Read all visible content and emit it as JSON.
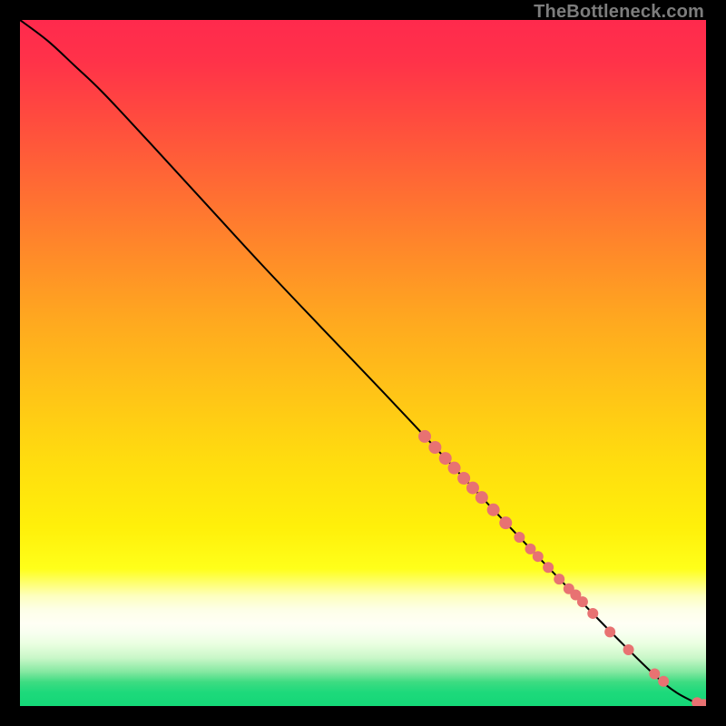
{
  "watermark": "TheBottleneck.com",
  "colors": {
    "black": "#000000",
    "curve": "#000000",
    "point": "#e87272",
    "gradient_stops": [
      {
        "offset": 0.0,
        "color": "#ff2a4d"
      },
      {
        "offset": 0.06,
        "color": "#ff3249"
      },
      {
        "offset": 0.14,
        "color": "#ff4a3f"
      },
      {
        "offset": 0.24,
        "color": "#ff6a34"
      },
      {
        "offset": 0.34,
        "color": "#ff8a29"
      },
      {
        "offset": 0.44,
        "color": "#ffa91f"
      },
      {
        "offset": 0.54,
        "color": "#ffc317"
      },
      {
        "offset": 0.64,
        "color": "#ffdc0f"
      },
      {
        "offset": 0.74,
        "color": "#fff00a"
      },
      {
        "offset": 0.8,
        "color": "#ffff1a"
      },
      {
        "offset": 0.84,
        "color": "#fdffc0"
      },
      {
        "offset": 0.86,
        "color": "#fdffe8"
      },
      {
        "offset": 0.88,
        "color": "#fffff5"
      },
      {
        "offset": 0.895,
        "color": "#f7ffef"
      },
      {
        "offset": 0.91,
        "color": "#e9ffe0"
      },
      {
        "offset": 0.93,
        "color": "#c9f7c8"
      },
      {
        "offset": 0.95,
        "color": "#85e8a1"
      },
      {
        "offset": 0.965,
        "color": "#3ddc82"
      },
      {
        "offset": 0.98,
        "color": "#1dd97b"
      },
      {
        "offset": 1.0,
        "color": "#14d877"
      }
    ]
  },
  "chart_data": {
    "type": "line",
    "title": "",
    "xlabel": "",
    "ylabel": "",
    "xlim": [
      0,
      100
    ],
    "ylim": [
      0,
      100
    ],
    "legend": false,
    "grid": false,
    "curve": [
      {
        "x": 0,
        "y": 100
      },
      {
        "x": 4,
        "y": 97
      },
      {
        "x": 8,
        "y": 93.3
      },
      {
        "x": 12,
        "y": 89.5
      },
      {
        "x": 18,
        "y": 83.1
      },
      {
        "x": 26,
        "y": 74.4
      },
      {
        "x": 35,
        "y": 64.6
      },
      {
        "x": 44,
        "y": 55.1
      },
      {
        "x": 53,
        "y": 45.7
      },
      {
        "x": 62,
        "y": 36.1
      },
      {
        "x": 71,
        "y": 26.5
      },
      {
        "x": 80,
        "y": 17.1
      },
      {
        "x": 88,
        "y": 8.9
      },
      {
        "x": 94,
        "y": 3.2
      },
      {
        "x": 98,
        "y": 0.7
      },
      {
        "x": 100,
        "y": 0
      }
    ],
    "points": [
      {
        "x": 59.0,
        "y": 39.3,
        "r": 7
      },
      {
        "x": 60.5,
        "y": 37.7,
        "r": 7
      },
      {
        "x": 62.0,
        "y": 36.1,
        "r": 7
      },
      {
        "x": 63.3,
        "y": 34.7,
        "r": 7
      },
      {
        "x": 64.7,
        "y": 33.2,
        "r": 7
      },
      {
        "x": 66.0,
        "y": 31.8,
        "r": 7
      },
      {
        "x": 67.3,
        "y": 30.4,
        "r": 7
      },
      {
        "x": 69.0,
        "y": 28.6,
        "r": 7
      },
      {
        "x": 70.8,
        "y": 26.7,
        "r": 7
      },
      {
        "x": 72.8,
        "y": 24.6,
        "r": 6
      },
      {
        "x": 74.4,
        "y": 22.9,
        "r": 6
      },
      {
        "x": 75.5,
        "y": 21.8,
        "r": 6
      },
      {
        "x": 77.0,
        "y": 20.2,
        "r": 6
      },
      {
        "x": 78.6,
        "y": 18.5,
        "r": 6
      },
      {
        "x": 80.0,
        "y": 17.1,
        "r": 6
      },
      {
        "x": 81.0,
        "y": 16.2,
        "r": 6
      },
      {
        "x": 82.0,
        "y": 15.2,
        "r": 6
      },
      {
        "x": 83.5,
        "y": 13.5,
        "r": 6
      },
      {
        "x": 86.0,
        "y": 10.8,
        "r": 6
      },
      {
        "x": 88.7,
        "y": 8.2,
        "r": 6
      },
      {
        "x": 92.5,
        "y": 4.7,
        "r": 6
      },
      {
        "x": 93.8,
        "y": 3.6,
        "r": 6
      },
      {
        "x": 98.7,
        "y": 0.5,
        "r": 6
      },
      {
        "x": 99.7,
        "y": 0.1,
        "r": 7
      },
      {
        "x": 100.5,
        "y": 0.0,
        "r": 7
      }
    ]
  }
}
